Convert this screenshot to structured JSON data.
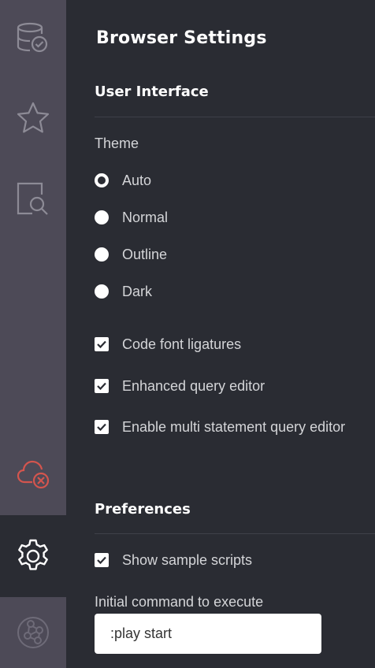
{
  "sidebar": {
    "items": [
      {
        "icon": "database-check-icon"
      },
      {
        "icon": "star-icon"
      },
      {
        "icon": "document-search-icon"
      },
      {
        "icon": "cloud-disconnected-icon",
        "color": "#d4554e"
      },
      {
        "icon": "gear-icon",
        "active": true
      },
      {
        "icon": "neo4j-logo-icon"
      }
    ]
  },
  "main": {
    "title": "Browser Settings",
    "user_interface": {
      "heading": "User Interface",
      "theme_label": "Theme",
      "theme_options": [
        "Auto",
        "Normal",
        "Outline",
        "Dark"
      ],
      "theme_selected": "Auto",
      "checkboxes": [
        {
          "label": "Code font ligatures",
          "checked": true
        },
        {
          "label": "Enhanced query editor",
          "checked": true
        },
        {
          "label": "Enable multi statement query editor",
          "checked": true
        }
      ]
    },
    "preferences": {
      "heading": "Preferences",
      "show_sample_scripts": {
        "label": "Show sample scripts",
        "checked": true
      },
      "initial_command_label": "Initial command to execute",
      "initial_command_value": ":play start"
    }
  },
  "colors": {
    "rail_bg": "#4d4a57",
    "main_bg": "#2a2c33",
    "alert_red": "#d4554e"
  }
}
